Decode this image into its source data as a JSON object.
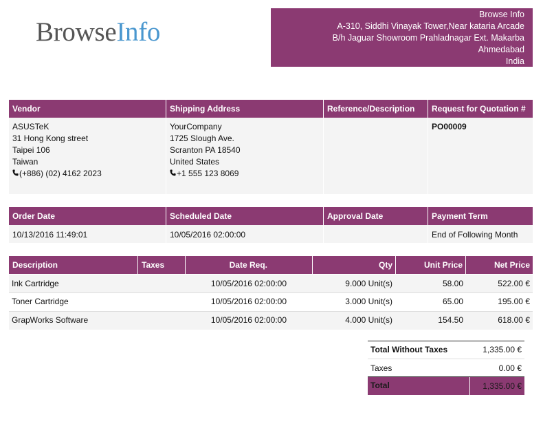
{
  "logo": {
    "part1": "Browse",
    "part2": "Info"
  },
  "company": {
    "lines": [
      "Browse Info",
      "A-310, Siddhi Vinayak Tower,Near kataria Arcade",
      "B/h Jaguar Showroom Prahladnagar Ext. Makarba",
      "Ahmedabad",
      "India"
    ]
  },
  "info_headers": {
    "vendor": "Vendor",
    "shipping": "Shipping Address",
    "reference": "Reference/Description",
    "rfq": "Request for Quotation #"
  },
  "vendor": {
    "lines": [
      "ASUSTeK",
      "31 Hong Kong street",
      "Taipei 106",
      "Taiwan"
    ],
    "phone": "(+886) (02) 4162 2023"
  },
  "shipping": {
    "lines": [
      "YourCompany",
      "1725 Slough Ave.",
      "Scranton PA 18540",
      "United States"
    ],
    "phone": "+1 555 123 8069"
  },
  "rfq_number": "PO00009",
  "date_headers": {
    "order": "Order Date",
    "scheduled": "Scheduled Date",
    "approval": "Approval Date",
    "payment": "Payment Term"
  },
  "dates": {
    "order": "10/13/2016 11:49:01",
    "scheduled": "10/05/2016 02:00:00",
    "approval": "",
    "payment": "End of Following Month"
  },
  "line_headers": {
    "description": "Description",
    "taxes": "Taxes",
    "date_req": "Date Req.",
    "qty": "Qty",
    "unit_price": "Unit Price",
    "net_price": "Net Price"
  },
  "lines": [
    {
      "description": "Ink Cartridge",
      "taxes": "",
      "date_req": "10/05/2016 02:00:00",
      "qty": "9.000 Unit(s)",
      "unit_price": "58.00",
      "net_price": "522.00 €"
    },
    {
      "description": "Toner Cartridge",
      "taxes": "",
      "date_req": "10/05/2016 02:00:00",
      "qty": "3.000 Unit(s)",
      "unit_price": "65.00",
      "net_price": "195.00 €"
    },
    {
      "description": "GrapWorks Software",
      "taxes": "",
      "date_req": "10/05/2016 02:00:00",
      "qty": "4.000 Unit(s)",
      "unit_price": "154.50",
      "net_price": "618.00 €"
    }
  ],
  "totals": {
    "without_taxes_label": "Total Without Taxes",
    "without_taxes": "1,335.00 €",
    "taxes_label": "Taxes",
    "taxes": "0.00 €",
    "total_label": "Total",
    "total": "1,335.00 €"
  },
  "colors": {
    "accent": "#8b3a72",
    "logo_blue": "#4a97cf",
    "logo_grey": "#555555"
  },
  "icons": {
    "phone": "phone-icon"
  }
}
